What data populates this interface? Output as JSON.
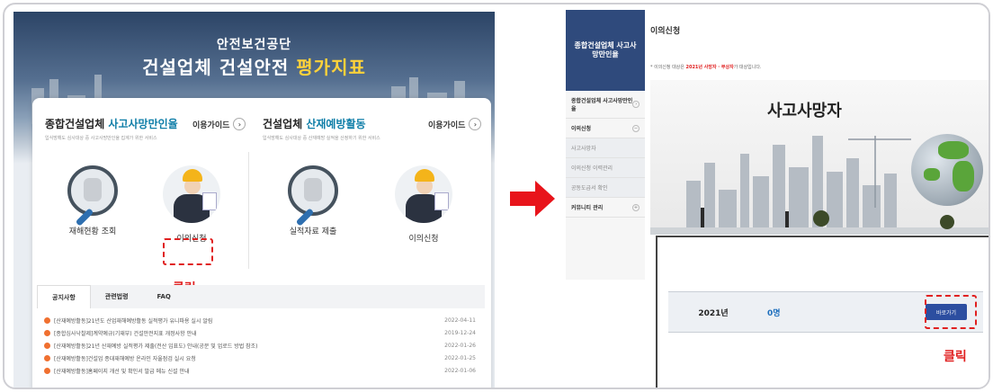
{
  "left": {
    "header": {
      "subtitle": "안전보건공단",
      "title_main": "건설업체 건설안전 ",
      "title_highlight": "평가지표"
    },
    "section1": {
      "title_main": "종합건설업체 ",
      "title_highlight": "사고사망만인율",
      "desc": "입식방해도 심사대상 중 사고사망만인율 집계가 위한 서비스",
      "guide": "이용가이드"
    },
    "section2": {
      "title_main": "건설업체 ",
      "title_highlight": "산재예방활동",
      "desc": "입식방해도 심사대상 중 산재예방 실적을 산정하기 위한 서비스",
      "guide": "이용가이드"
    },
    "icons": [
      {
        "label": "재해현황 조회"
      },
      {
        "label": "이의신청"
      },
      {
        "label": "실적자료 제출"
      },
      {
        "label": "이의신청"
      }
    ],
    "click_label": "클릭",
    "tabs": [
      "공지사항",
      "관련법령",
      "FAQ"
    ],
    "news": [
      {
        "title": "[산재예방활동]21년도 산업재해예방활동 실적평가 유니파용 실시 알림",
        "date": "2022-04-11"
      },
      {
        "title": "[종합심사낙찰제]계약예규(기재부) 건설안전지표 개정사항 안내",
        "date": "2019-12-24"
      },
      {
        "title": "[산재예방활동]21년 산재예방 실적평가 제출(전산 입표도) 안내(공문 및 업로드 방법 참조)",
        "date": "2022-01-26"
      },
      {
        "title": "[산재예방활동]건설업 종대재해예방 온라인 자율점검 실시 요청",
        "date": "2022-01-25"
      },
      {
        "title": "[산재예방활동]홈페이지 개선 및 확인서 발급 메뉴 신설 안내",
        "date": "2022-01-06"
      }
    ]
  },
  "right": {
    "sidebar": {
      "header": "종합건설업체 사고사망만인율",
      "items": [
        {
          "label": "종합건설업체 사고사망만인율"
        },
        {
          "label": "이의신청"
        },
        {
          "label": "사고사망자"
        },
        {
          "label": "이의신청 이력관리"
        },
        {
          "label": "공동도급서 확인"
        },
        {
          "label": "커뮤니티 관리"
        }
      ]
    },
    "page_title": "이의신청",
    "note_prefix": "* 이의신청 대상은 ",
    "note_highlight": "2021년 사망자 · 부상자",
    "note_suffix": "가 대상입니다.",
    "banner_title": "사고사망자",
    "result": {
      "year": "2021년",
      "value": "0명",
      "button": "바로가기"
    },
    "click_label": "클릭"
  },
  "colors": {
    "accent": "#0f7ea8",
    "highlight_red": "#e02020",
    "sidebar_blue": "#2f4a7c",
    "button_blue": "#2c4ea0"
  }
}
